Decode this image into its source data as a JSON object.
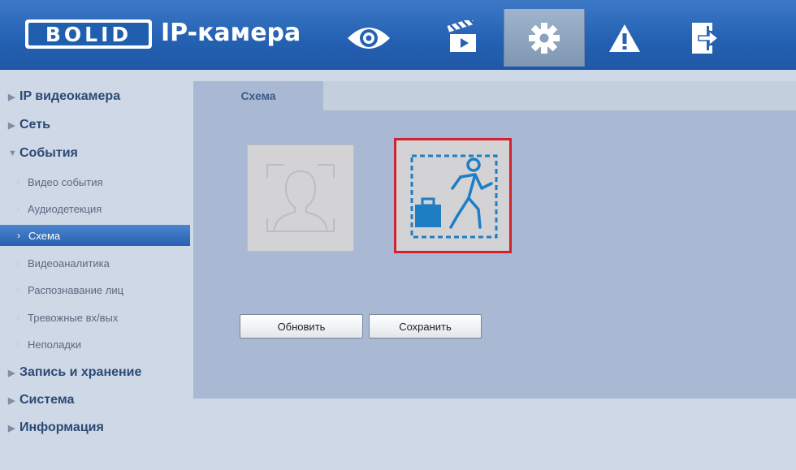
{
  "header": {
    "logo": "BOLID",
    "title": "IP-камера",
    "nav": [
      {
        "icon": "eye-icon"
      },
      {
        "icon": "clapperboard-icon"
      },
      {
        "icon": "gear-icon",
        "active": true
      },
      {
        "icon": "alarm-icon"
      },
      {
        "icon": "logout-icon"
      }
    ]
  },
  "sidebar": {
    "items": [
      {
        "label": "IP видеокамера",
        "level": 1,
        "expanded": false
      },
      {
        "label": "Сеть",
        "level": 1,
        "expanded": false
      },
      {
        "label": "События",
        "level": 1,
        "expanded": true
      },
      {
        "label": "Видео события",
        "level": 2
      },
      {
        "label": "Аудиодетекция",
        "level": 2
      },
      {
        "label": "Схема",
        "level": 2,
        "active": true
      },
      {
        "label": "Видеоаналитика",
        "level": 2
      },
      {
        "label": "Распознавание лиц",
        "level": 2
      },
      {
        "label": "Тревожные вх/вых",
        "level": 2
      },
      {
        "label": "Неполадки",
        "level": 2
      },
      {
        "label": "Запись и хранение",
        "level": 1,
        "expanded": false
      },
      {
        "label": "Система",
        "level": 1,
        "expanded": false
      },
      {
        "label": "Информация",
        "level": 1,
        "expanded": false
      }
    ]
  },
  "main": {
    "tab": "Схема",
    "schemes": [
      {
        "icon": "face-recognition-icon",
        "selected": false
      },
      {
        "icon": "abandoned-object-icon",
        "selected": true
      }
    ],
    "buttons": {
      "refresh": "Обновить",
      "save": "Сохранить"
    }
  },
  "colors": {
    "header": "#2562b3",
    "active_item": "#2861b0",
    "selection_border": "#d0212d",
    "content_bg": "#a9b9d3"
  }
}
